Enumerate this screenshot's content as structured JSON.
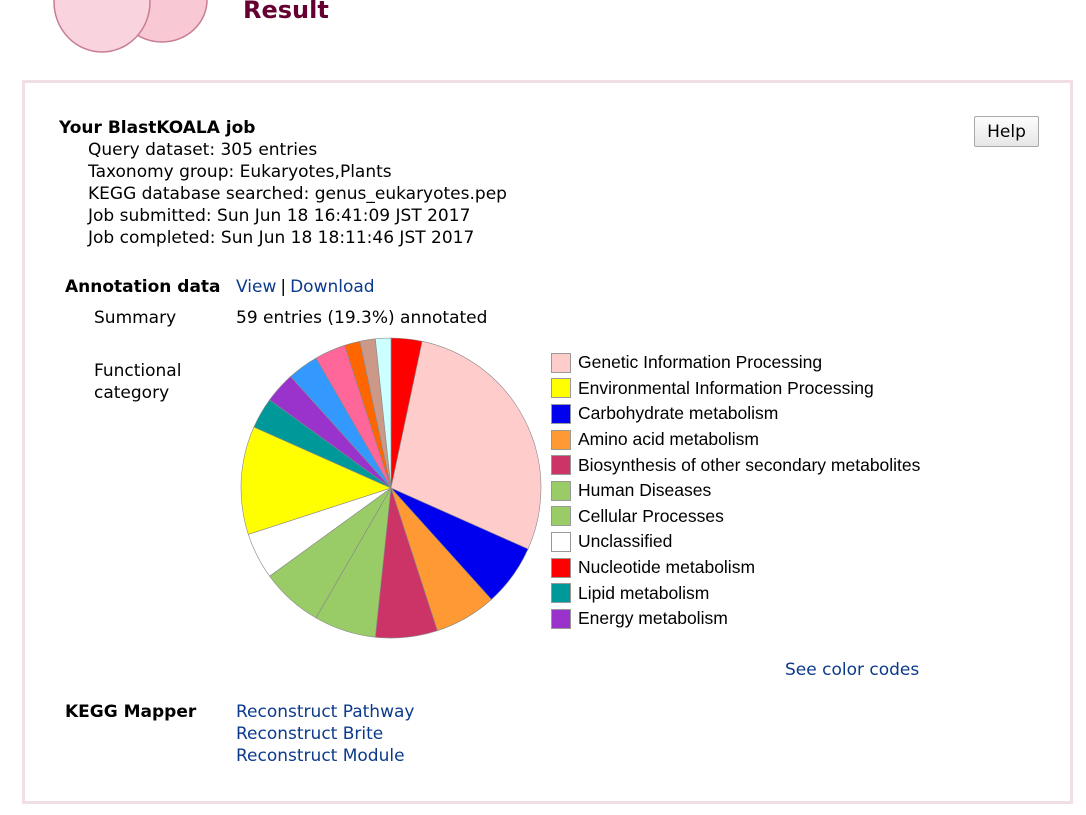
{
  "header": {
    "title": "Result"
  },
  "help_button": {
    "label": "Help"
  },
  "job": {
    "title": "Your BlastKOALA job",
    "lines": [
      "Query dataset: 305 entries",
      "Taxonomy group: Eukaryotes,Plants",
      "KEGG database searched: genus_eukaryotes.pep",
      "Job submitted: Sun Jun 18 16:41:09 JST 2017",
      "Job completed: Sun Jun 18 18:11:46 JST 2017"
    ]
  },
  "annotation": {
    "label": "Annotation data",
    "view_link": "View",
    "separator": "|",
    "download_link": "Download",
    "summary_label": "Summary",
    "summary_value": "59 entries (19.3%) annotated",
    "functional_label_line1": "Functional",
    "functional_label_line2": "category",
    "see_color_codes": "See color codes"
  },
  "chart_data": {
    "type": "pie",
    "slices": [
      {
        "label": "Nucleotide metabolism",
        "value": 2,
        "color": "#ff0000"
      },
      {
        "label": "Genetic Information Processing",
        "value": 17,
        "color": "#ffcccc"
      },
      {
        "label": "Carbohydrate metabolism",
        "value": 4,
        "color": "#0000ee"
      },
      {
        "label": "Amino acid metabolism",
        "value": 4,
        "color": "#ff9933"
      },
      {
        "label": "Biosynthesis of other secondary metabolites",
        "value": 4,
        "color": "#cc3366"
      },
      {
        "label": "Human Diseases",
        "value": 4,
        "color": "#99cc66"
      },
      {
        "label": "Cellular Processes",
        "value": 4,
        "color": "#99cc66"
      },
      {
        "label": "Unclassified",
        "value": 3,
        "color": "#ffffff"
      },
      {
        "label": "Environmental Information Processing",
        "value": 7,
        "color": "#ffff00"
      },
      {
        "label": "Lipid metabolism",
        "value": 2,
        "color": "#009999"
      },
      {
        "label": "Energy metabolism",
        "value": 2,
        "color": "#9933cc"
      },
      {
        "label": "",
        "value": 2,
        "color": "#3399ff"
      },
      {
        "label": "",
        "value": 2,
        "color": "#ff6699"
      },
      {
        "label": "",
        "value": 1,
        "color": "#ff6600"
      },
      {
        "label": "",
        "value": 1,
        "color": "#cc9988"
      },
      {
        "label": "",
        "value": 1,
        "color": "#ccffff"
      }
    ],
    "legend": [
      {
        "label": "Genetic Information Processing",
        "color": "#ffcccc"
      },
      {
        "label": "Environmental Information Processing",
        "color": "#ffff00"
      },
      {
        "label": "Carbohydrate metabolism",
        "color": "#0000ee"
      },
      {
        "label": "Amino acid metabolism",
        "color": "#ff9933"
      },
      {
        "label": "Biosynthesis of other secondary metabolites",
        "color": "#cc3366"
      },
      {
        "label": "Human Diseases",
        "color": "#99cc66"
      },
      {
        "label": "Cellular Processes",
        "color": "#99cc66"
      },
      {
        "label": "Unclassified",
        "color": "#ffffff"
      },
      {
        "label": "Nucleotide metabolism",
        "color": "#ff0000"
      },
      {
        "label": "Lipid metabolism",
        "color": "#009999"
      },
      {
        "label": "Energy metabolism",
        "color": "#9933cc"
      }
    ],
    "legend_placement": "right"
  },
  "mapper": {
    "label": "KEGG Mapper",
    "links": [
      "Reconstruct Pathway",
      "Reconstruct Brite",
      "Reconstruct Module"
    ]
  },
  "colors": {
    "title": "#660033",
    "link": "#0b3a8c",
    "panel_border": "#f2dfe6"
  }
}
